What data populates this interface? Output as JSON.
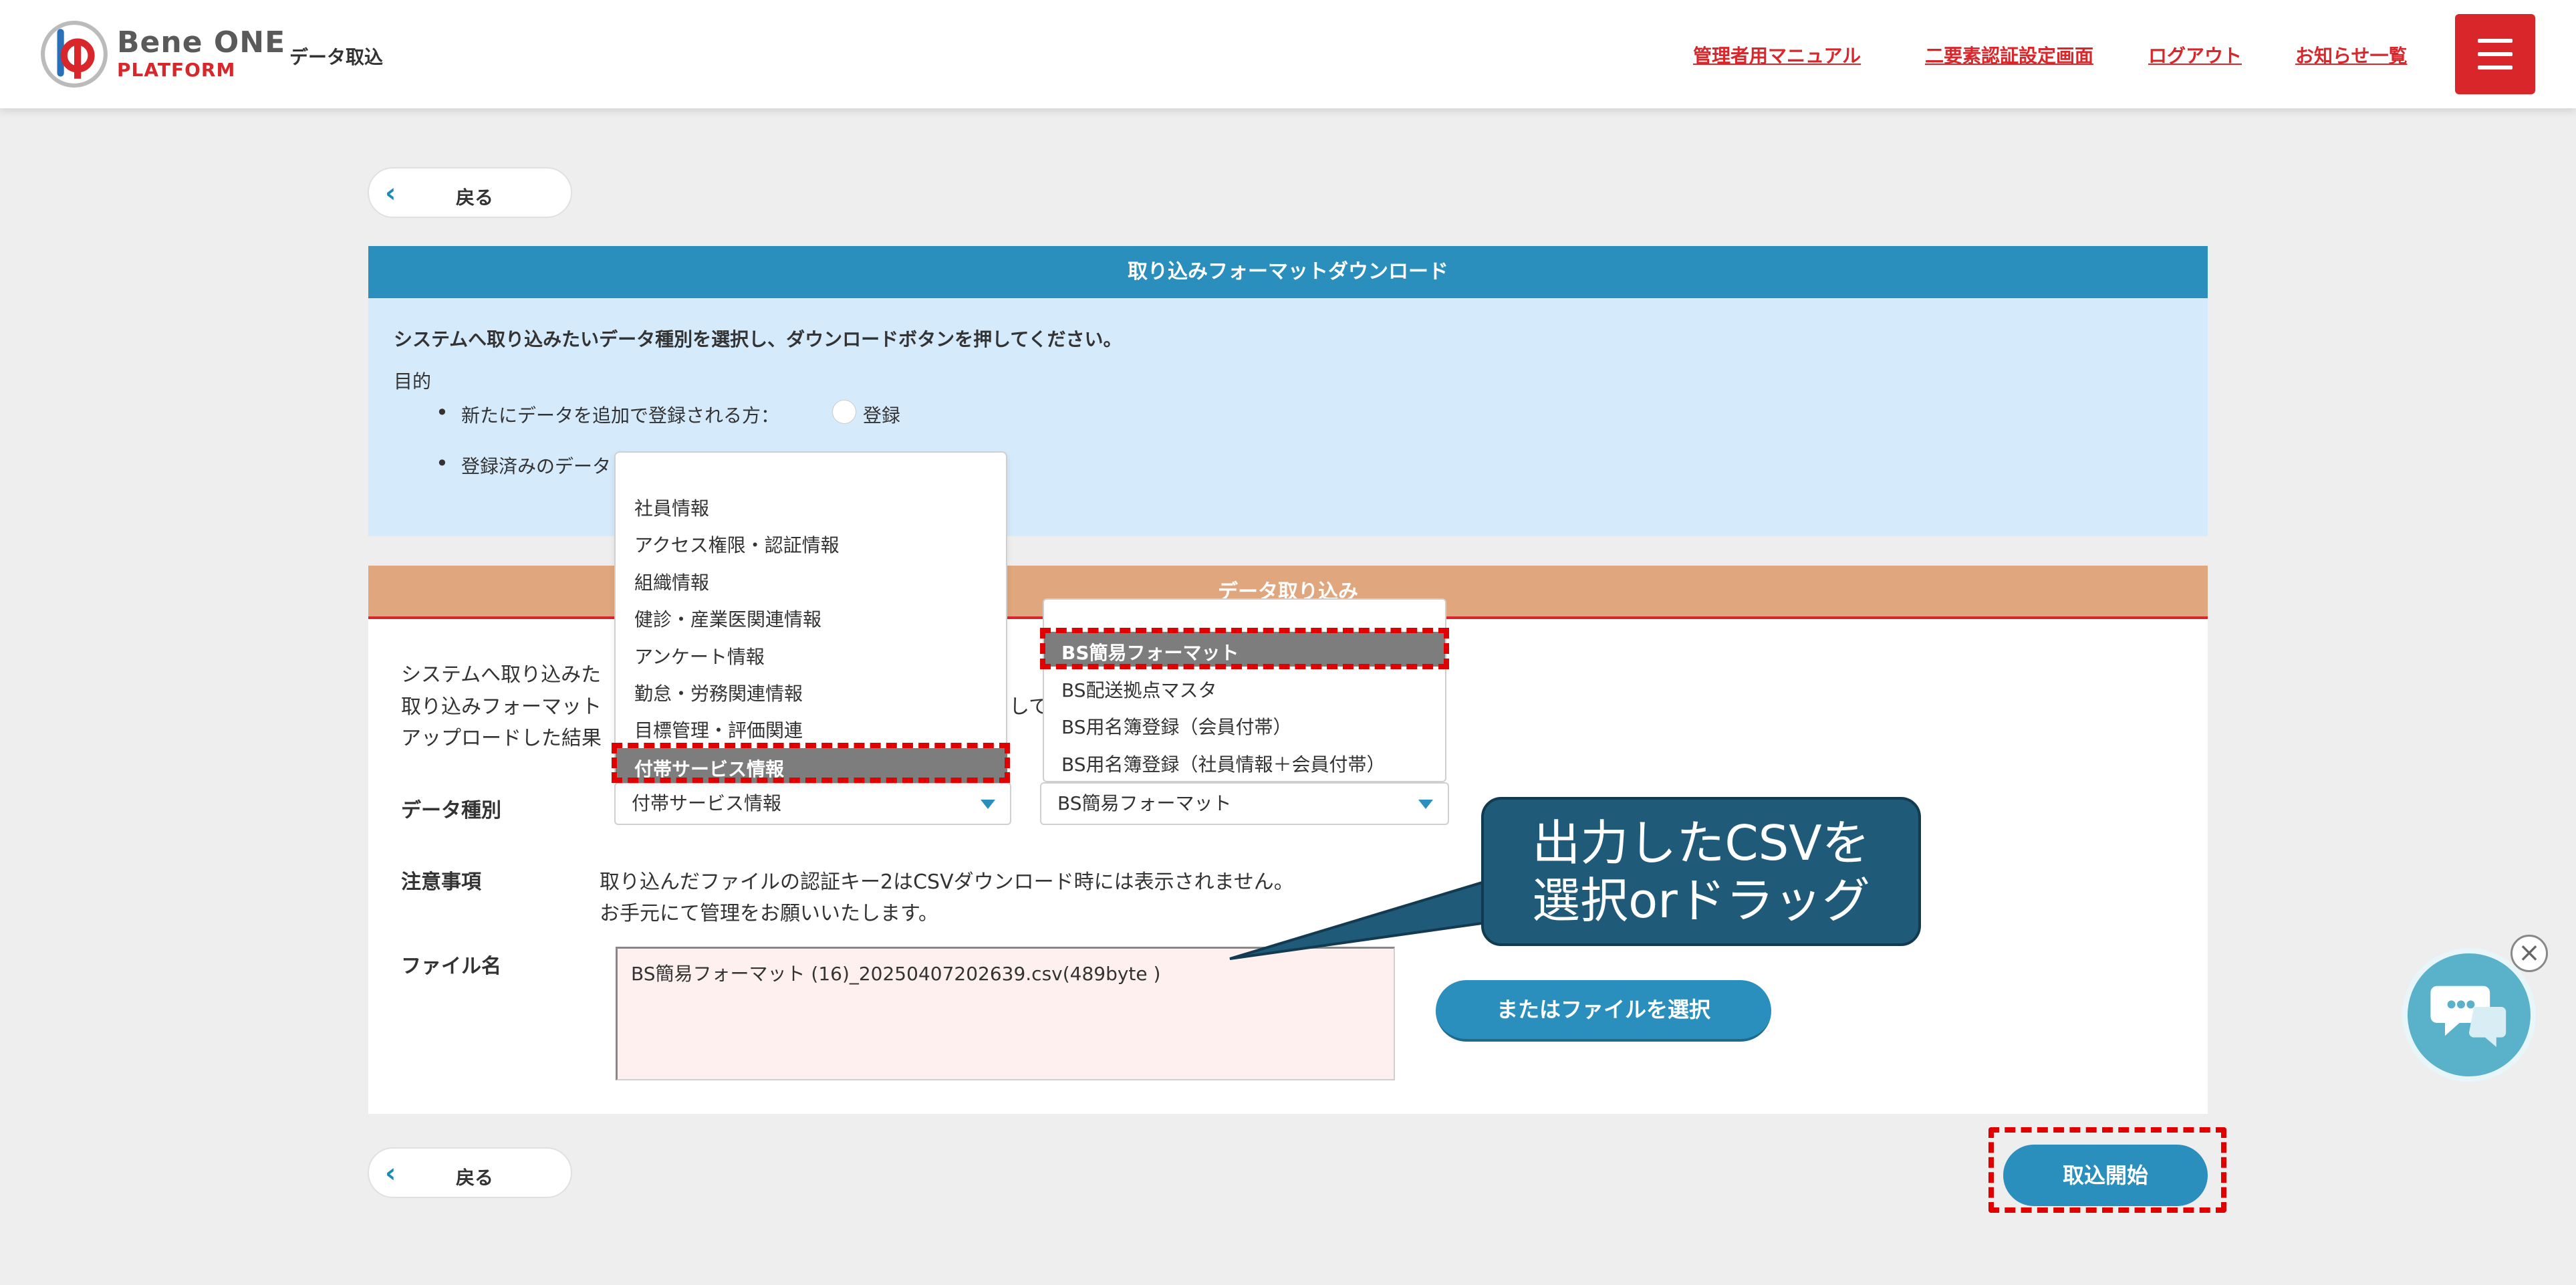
{
  "header": {
    "brand_line1": "Bene ONE",
    "brand_line2": "PLATFORM",
    "page_title": "データ取込",
    "links": [
      "管理者用マニュアル",
      "二要素認証設定画面",
      "ログアウト",
      "お知らせ一覧"
    ],
    "accent_color": "#d8262b"
  },
  "back_button": {
    "label": "戻る",
    "icon": "chevron-left-icon"
  },
  "download_panel": {
    "title": "取り込みフォーマットダウンロード",
    "instruction": "システムへ取り込みたいデータ種別を選択し、ダウンロードボタンを押してください。",
    "purpose_label": "目的",
    "bullet_new": "新たにデータを追加で登録される方：",
    "radio_label": "登録",
    "bullet_existing": "登録済みのデータ"
  },
  "import_panel": {
    "title": "データ取り込み",
    "desc_line1": "システムへ取り込みた",
    "desc_line2": "取り込みフォーマット",
    "desc_line2_tail": "して",
    "desc_line3": "アップロードした結果",
    "data_type_label": "データ種別",
    "data_type_value": "付帯サービス情報",
    "format_value": "BS簡易フォーマット",
    "notes_label": "注意事項",
    "notes_line1": "取り込んだファイルの認証キー2はCSVダウンロード時には表示されません。",
    "notes_line2": "お手元にて管理をお願いいたします。",
    "file_label": "ファイル名",
    "file_name": "BS簡易フォーマット (16)_20250407202639.csv(489byte )",
    "choose_button": "またはファイルを選択",
    "start_button": "取込開始"
  },
  "data_type_options": [
    "社員情報",
    "アクセス権限・認証情報",
    "組織情報",
    "健診・産業医関連情報",
    "アンケート情報",
    "勤怠・労務関連情報",
    "目標管理・評価関連",
    "付帯サービス情報"
  ],
  "format_options": [
    "BS簡易フォーマット",
    "BS配送拠点マスタ",
    "BS用名簿登録（会員付帯）",
    "BS用名簿登録（社員情報＋会員付帯）"
  ],
  "callout": {
    "line1": "出力したCSVを",
    "line2": "選択orドラッグ"
  },
  "chat": {
    "icon": "chat-icon",
    "close_icon": "close-icon"
  }
}
